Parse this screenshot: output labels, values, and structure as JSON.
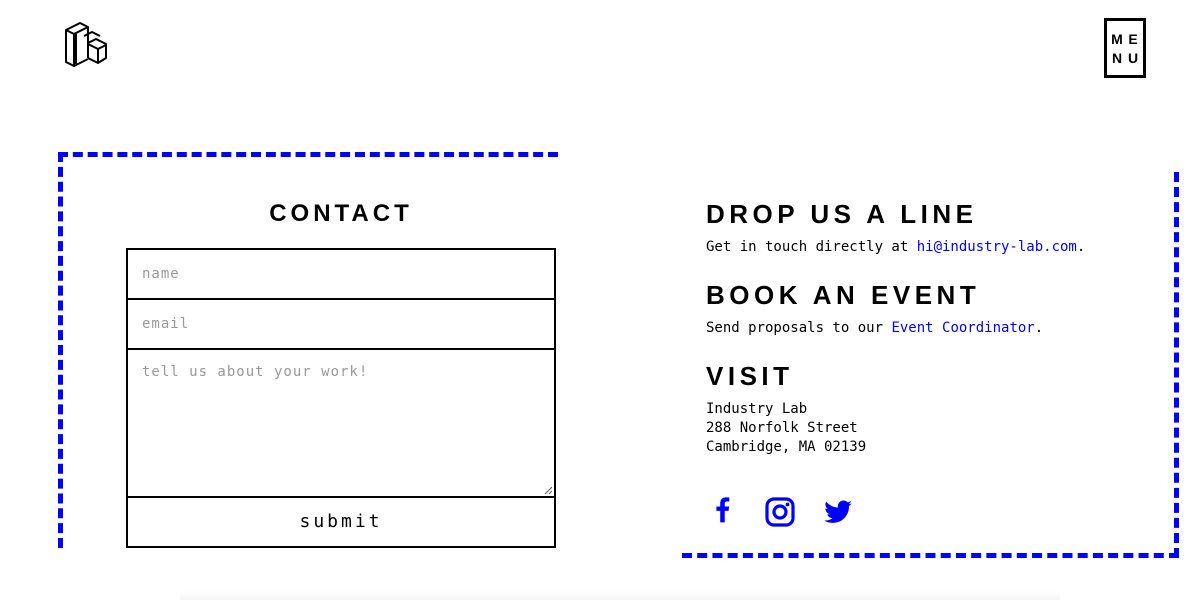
{
  "header": {
    "logo_icon": "industry-lab-cubes-logo",
    "menu_letters": [
      "M",
      "E",
      "N",
      "U"
    ]
  },
  "contact": {
    "title": "CONTACT",
    "name_placeholder": "name",
    "email_placeholder": "email",
    "message_placeholder": "tell us about your work!",
    "submit_label": "submit"
  },
  "drop_line": {
    "title": "DROP US A LINE",
    "text_before": "Get in touch directly at ",
    "email_link": "hi@industry-lab.com",
    "text_after": "."
  },
  "book_event": {
    "title": "BOOK AN EVENT",
    "text_before": "Send proposals to our ",
    "link": "Event Coordinator",
    "text_after": "."
  },
  "visit": {
    "title": "VISIT",
    "address_lines": [
      "Industry Lab",
      "288 Norfolk Street",
      "Cambridge, MA 02139"
    ]
  },
  "social": {
    "icons": [
      "facebook-icon",
      "instagram-icon",
      "twitter-icon"
    ]
  },
  "colors": {
    "accent": "#0000ff",
    "text": "#000000",
    "placeholder": "#999999"
  }
}
